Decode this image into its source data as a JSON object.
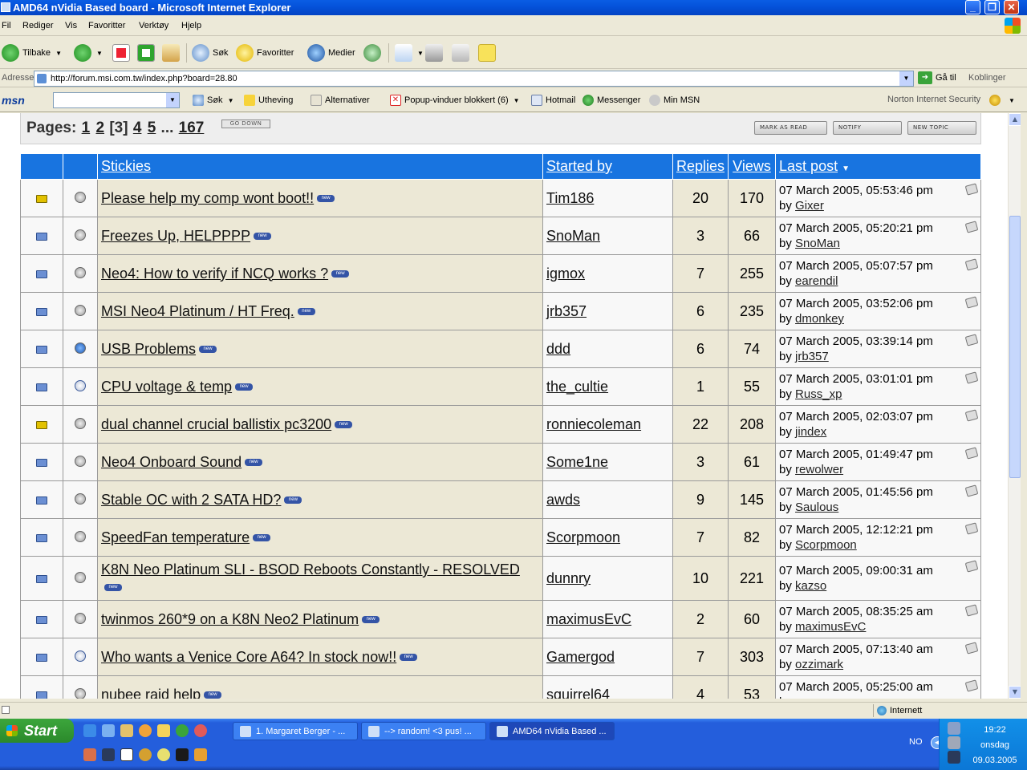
{
  "window": {
    "title": "AMD64 nVidia Based board - Microsoft Internet Explorer"
  },
  "menu": [
    "Fil",
    "Rediger",
    "Vis",
    "Favoritter",
    "Verktøy",
    "Hjelp"
  ],
  "toolbar": {
    "back": "Tilbake",
    "search": "Søk",
    "favorites": "Favoritter",
    "media": "Medier"
  },
  "address": {
    "label": "Adresse",
    "url": "http://forum.msi.com.tw/index.php?board=28.80",
    "go": "Gå til",
    "links": "Koblinger"
  },
  "msnbar": {
    "logo": "msn",
    "search": "Søk",
    "highlight": "Utheving",
    "options": "Alternativer",
    "popup": "Popup-vinduer blokkert (6)",
    "hotmail": "Hotmail",
    "messenger": "Messenger",
    "mymsn": "Min MSN",
    "norton": "Norton Internet Security"
  },
  "forum": {
    "pages_label": "Pages:",
    "pages": [
      "1",
      "2",
      "[3]",
      "4",
      "5",
      "...",
      "167"
    ],
    "go_down": "GO DOWN",
    "mark_read": "MARK AS READ",
    "notify": "NOTIFY",
    "new_topic": "NEW TOPIC",
    "new_badge": "new",
    "headers": {
      "subject": "Stickies",
      "started_by": "Started by",
      "replies": "Replies",
      "views": "Views",
      "last_post": "Last post"
    },
    "topics": [
      {
        "subject": "Please help my comp wont boot!!",
        "starter": "Tim186",
        "replies": "20",
        "views": "170",
        "last_time": "07 March 2005, 05:53:46 pm",
        "last_by": "Gixer",
        "hot": true,
        "icon": "standard"
      },
      {
        "subject": "Freezes Up, HELPPPP",
        "starter": "SnoMan",
        "replies": "3",
        "views": "66",
        "last_time": "07 March 2005, 05:20:21 pm",
        "last_by": "SnoMan",
        "hot": false,
        "icon": "standard"
      },
      {
        "subject": "Neo4: How to verify if NCQ works ?",
        "starter": "igmox",
        "replies": "7",
        "views": "255",
        "last_time": "07 March 2005, 05:07:57 pm",
        "last_by": "earendil",
        "hot": false,
        "icon": "standard"
      },
      {
        "subject": "MSI Neo4 Platinum / HT Freq.",
        "starter": "jrb357",
        "replies": "6",
        "views": "235",
        "last_time": "07 March 2005, 03:52:06 pm",
        "last_by": "dmonkey",
        "hot": false,
        "icon": "standard"
      },
      {
        "subject": "USB Problems",
        "starter": "ddd",
        "replies": "6",
        "views": "74",
        "last_time": "07 March 2005, 03:39:14 pm",
        "last_by": "jrb357",
        "hot": false,
        "icon": "bulb"
      },
      {
        "subject": "CPU voltage & temp",
        "starter": "the_cultie",
        "replies": "1",
        "views": "55",
        "last_time": "07 March 2005, 03:01:01 pm",
        "last_by": "Russ_xp",
        "hot": false,
        "icon": "excl"
      },
      {
        "subject": "dual channel crucial ballistix pc3200",
        "starter": "ronniecoleman",
        "replies": "22",
        "views": "208",
        "last_time": "07 March 2005, 02:03:07 pm",
        "last_by": "jindex",
        "hot": true,
        "icon": "standard"
      },
      {
        "subject": "Neo4 Onboard Sound",
        "starter": "Some1ne",
        "replies": "3",
        "views": "61",
        "last_time": "07 March 2005, 01:49:47 pm",
        "last_by": "rewolwer",
        "hot": false,
        "icon": "standard"
      },
      {
        "subject": "Stable OC with 2 SATA HD?",
        "starter": "awds",
        "replies": "9",
        "views": "145",
        "last_time": "07 March 2005, 01:45:56 pm",
        "last_by": "Saulous",
        "hot": false,
        "icon": "standard"
      },
      {
        "subject": "SpeedFan temperature",
        "starter": "Scorpmoon",
        "replies": "7",
        "views": "82",
        "last_time": "07 March 2005, 12:12:21 pm",
        "last_by": "Scorpmoon",
        "hot": false,
        "icon": "standard"
      },
      {
        "subject": "K8N Neo Platinum SLI - BSOD Reboots Constantly - RESOLVED",
        "starter": "dunnry",
        "replies": "10",
        "views": "221",
        "last_time": "07 March 2005, 09:00:31 am",
        "last_by": "kazso",
        "hot": false,
        "icon": "standard"
      },
      {
        "subject": "twinmos 260*9 on a K8N Neo2 Platinum",
        "starter": "maximusEvC",
        "replies": "2",
        "views": "60",
        "last_time": "07 March 2005, 08:35:25 am",
        "last_by": "maximusEvC",
        "hot": false,
        "icon": "standard"
      },
      {
        "subject": "Who wants a Venice Core A64? In stock now!!",
        "starter": "Gamergod",
        "replies": "7",
        "views": "303",
        "last_time": "07 March 2005, 07:13:40 am",
        "last_by": "ozzimark",
        "hot": false,
        "icon": "excl"
      },
      {
        "subject": "nubee raid help",
        "starter": "squirrel64",
        "replies": "4",
        "views": "53",
        "last_time": "07 March 2005, 05:25:00 am",
        "last_by": "",
        "hot": false,
        "icon": "standard"
      }
    ],
    "by_label": "by"
  },
  "status": {
    "zone": "Internett"
  },
  "taskbar": {
    "start": "Start",
    "tasks": [
      "1. Margaret Berger - ...",
      "--> random! <3 pus! ...",
      "AMD64 nVidia Based ..."
    ],
    "lang": "NO",
    "time": "19:22",
    "day": "onsdag",
    "date": "09.03.2005"
  }
}
